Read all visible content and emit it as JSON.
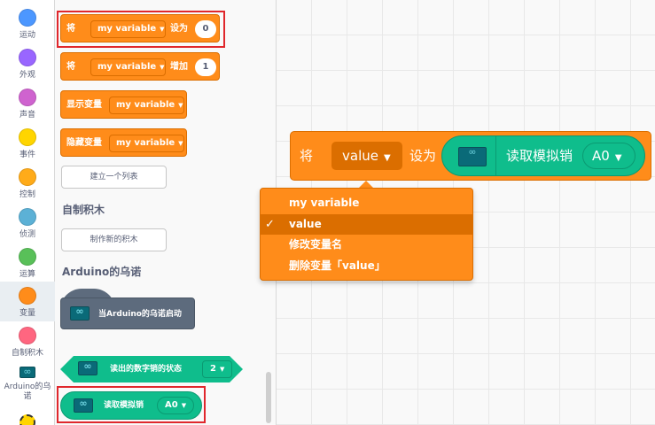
{
  "categories": [
    {
      "label": "运动",
      "color": "#4c97ff"
    },
    {
      "label": "外观",
      "color": "#9966ff"
    },
    {
      "label": "声音",
      "color": "#cf63cf"
    },
    {
      "label": "事件",
      "color": "#ffd500"
    },
    {
      "label": "控制",
      "color": "#ffab19"
    },
    {
      "label": "侦测",
      "color": "#5cb1d6"
    },
    {
      "label": "运算",
      "color": "#59c059"
    },
    {
      "label": "变量",
      "color": "#ff8c1a"
    },
    {
      "label": "自制积木",
      "color": "#ff6680"
    },
    {
      "label": "Arduino的乌\n诺",
      "color": "#0a6a78"
    }
  ],
  "palette": {
    "set_block": {
      "prefix": "将",
      "variable": "my variable",
      "middle": "设为",
      "value": "0"
    },
    "change_block": {
      "prefix": "将",
      "variable": "my variable",
      "middle": "增加",
      "value": "1"
    },
    "show_block": {
      "prefix": "显示变量",
      "variable": "my variable"
    },
    "hide_block": {
      "prefix": "隐藏变量",
      "variable": "my variable"
    },
    "make_list_button": "建立一个列表",
    "my_blocks_heading": "自制积木",
    "make_block_button": "制作新的积木",
    "arduino_heading": "Arduino的乌诺",
    "arduino_start_block": "当Arduino的乌诺启动",
    "digital_read_block": {
      "label": "读出的数字销的状态",
      "pin": "2"
    },
    "analog_read_block": {
      "label": "读取模拟销",
      "pin": "A0"
    }
  },
  "workspace": {
    "set_block": {
      "prefix": "将",
      "variable": "value",
      "middle": "设为"
    },
    "reporter": {
      "label": "读取模拟销",
      "pin": "A0"
    },
    "dropdown_options": [
      {
        "label": "my variable",
        "selected": false
      },
      {
        "label": "value",
        "selected": true
      },
      {
        "label": "修改变量名",
        "selected": false
      },
      {
        "label": "删除变量「value」",
        "selected": false
      }
    ],
    "checkmark": "✓"
  },
  "colors": {
    "variables": "#ff8c1a",
    "variables_dark": "#db6e00",
    "arduino": "#0fbd8c",
    "highlight": "#e0272c"
  }
}
